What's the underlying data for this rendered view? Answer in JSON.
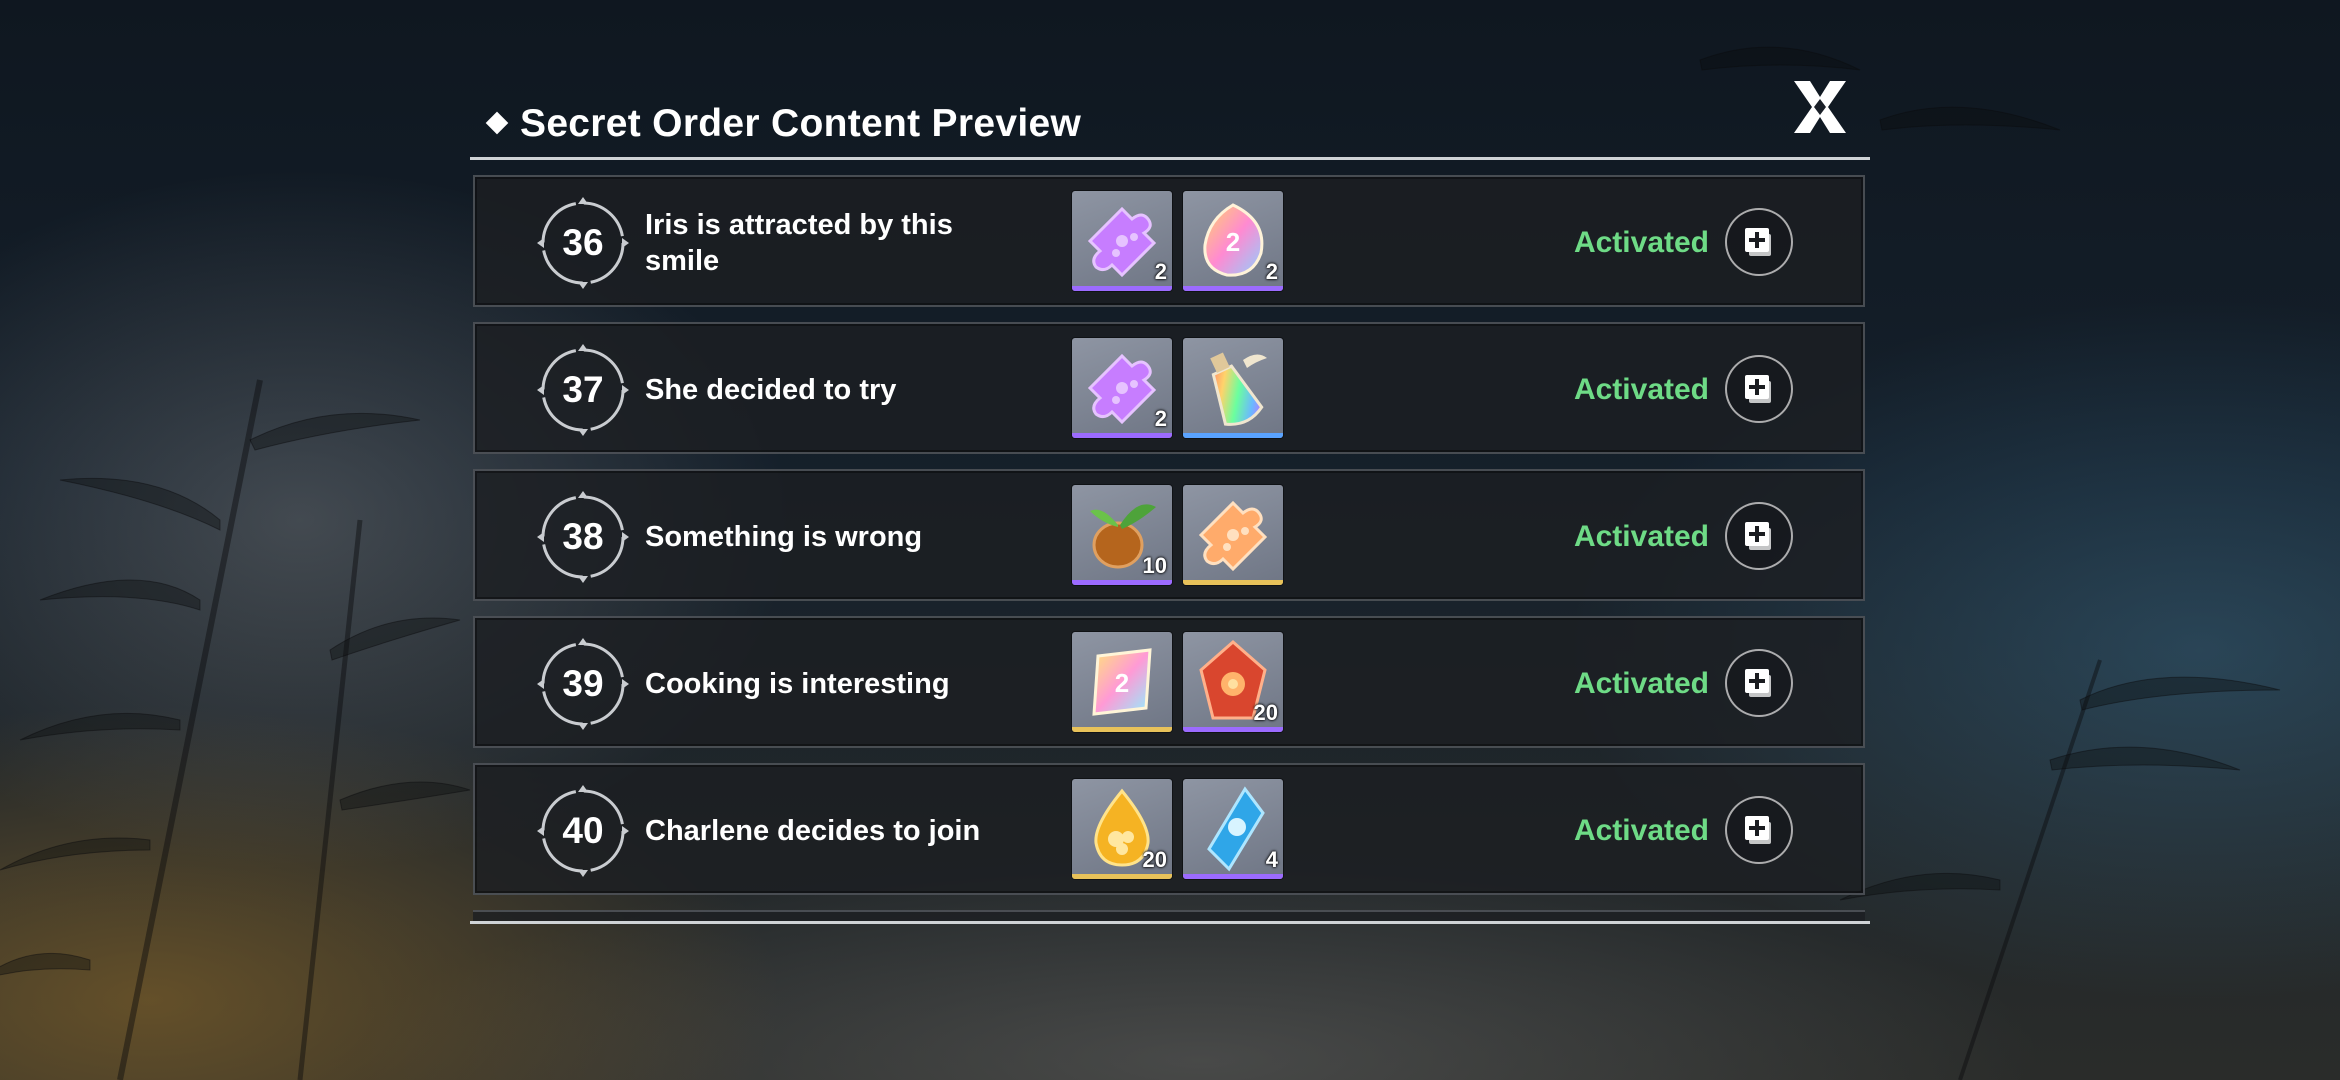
{
  "header": {
    "title": "Secret Order Content Preview"
  },
  "rows": [
    {
      "number": "36",
      "title": "Iris is attracted by this smile",
      "status": "Activated",
      "rewards": [
        {
          "icon": "purple-puzzle-icon",
          "count": "2",
          "rarity": "purple"
        },
        {
          "icon": "rainbow-gem-icon",
          "count": "2",
          "rarity": "purple"
        }
      ]
    },
    {
      "number": "37",
      "title": "She decided to try",
      "status": "Activated",
      "rewards": [
        {
          "icon": "purple-puzzle-icon",
          "count": "2",
          "rarity": "purple"
        },
        {
          "icon": "rainbow-bottle-icon",
          "count": "",
          "rarity": "blue"
        }
      ]
    },
    {
      "number": "38",
      "title": "Something is wrong",
      "status": "Activated",
      "rewards": [
        {
          "icon": "seed-bulb-icon",
          "count": "10",
          "rarity": "purple"
        },
        {
          "icon": "orange-puzzle-icon",
          "count": "",
          "rarity": "gold"
        }
      ]
    },
    {
      "number": "39",
      "title": "Cooking is interesting",
      "status": "Activated",
      "rewards": [
        {
          "icon": "rainbow-crystal-card-icon",
          "count": "",
          "rarity": "gold"
        },
        {
          "icon": "red-crystal-icon",
          "count": "20",
          "rarity": "purple"
        }
      ]
    },
    {
      "number": "40",
      "title": "Charlene decides to join",
      "status": "Activated",
      "rewards": [
        {
          "icon": "golden-drop-icon",
          "count": "20",
          "rarity": "gold"
        },
        {
          "icon": "blue-crystal-icon",
          "count": "4",
          "rarity": "purple"
        }
      ]
    }
  ],
  "colors": {
    "status_green": "#6edb86",
    "rarity_purple": "#9c6bff",
    "rarity_blue": "#5aa3ff",
    "rarity_gold": "#e8c25a"
  }
}
